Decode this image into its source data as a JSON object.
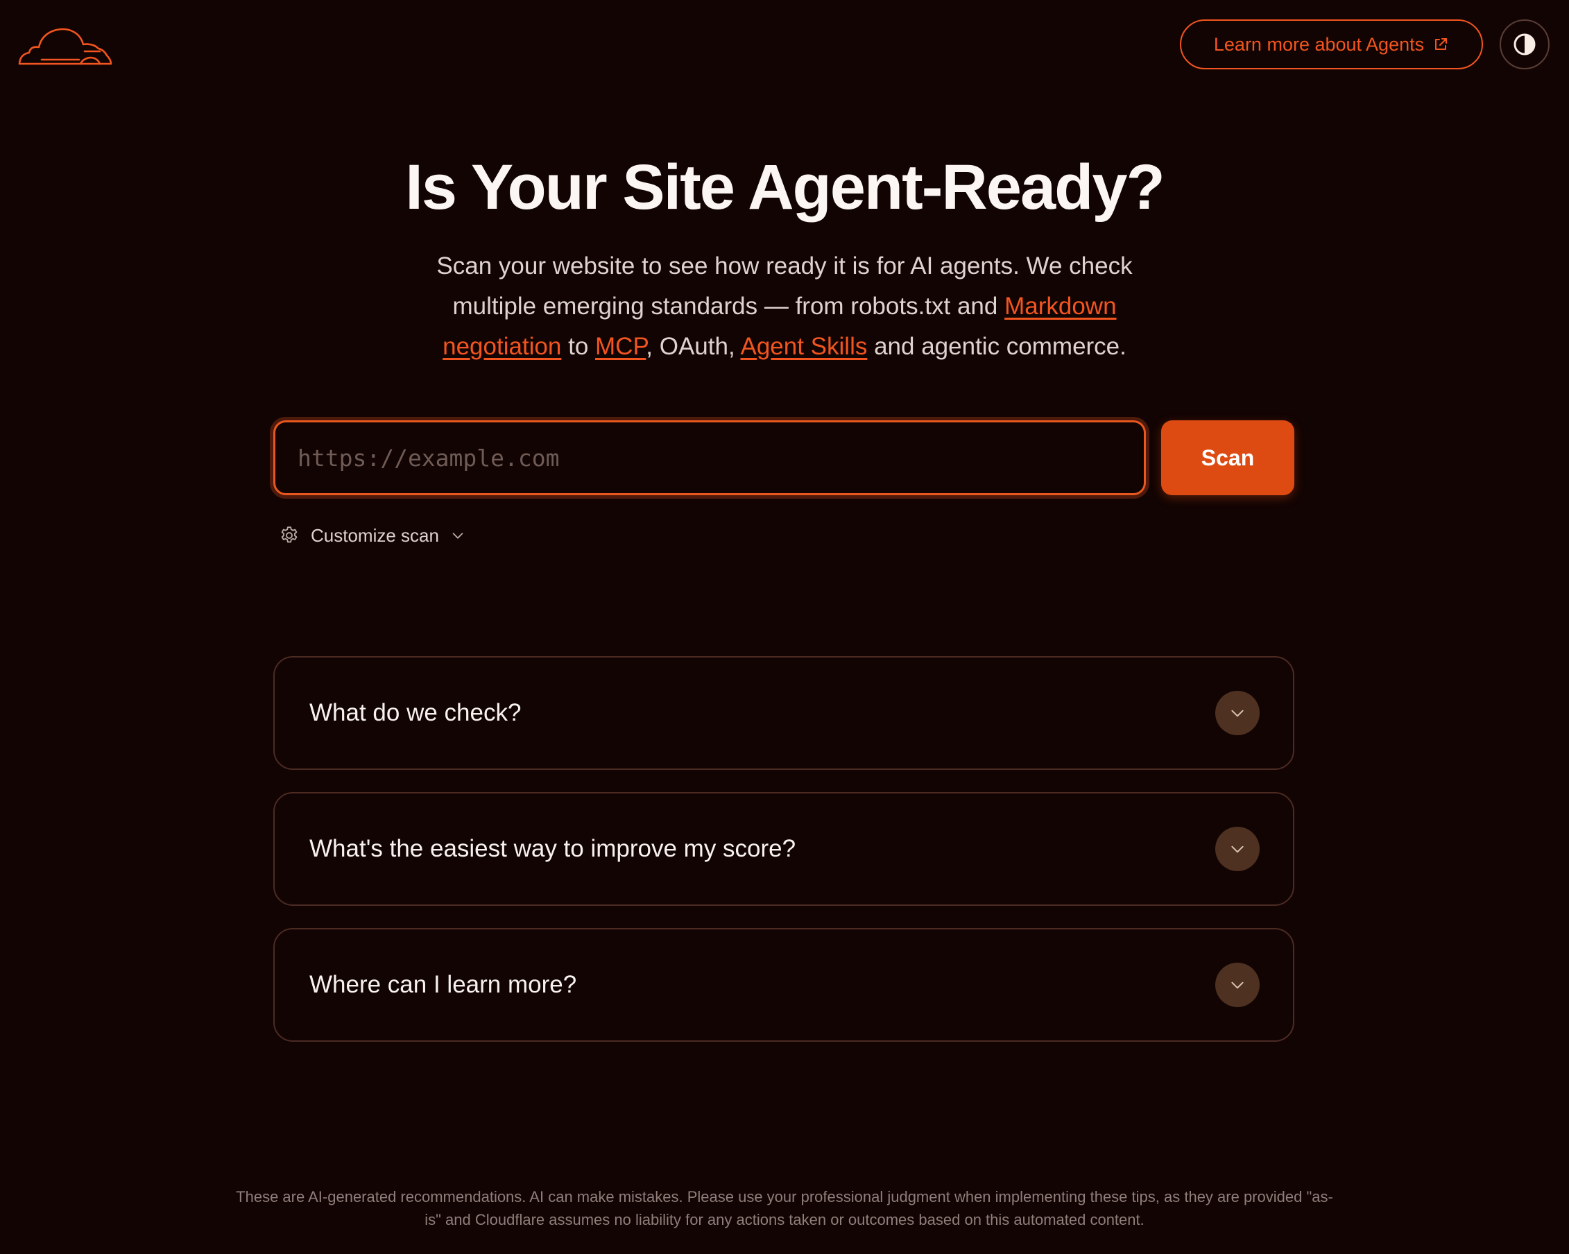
{
  "header": {
    "learn_more_label": "Learn more about Agents",
    "logo_icon": "cloud-logo-icon",
    "theme_icon": "contrast-icon"
  },
  "hero": {
    "title": "Is Your Site Agent-Ready?",
    "subtitle": {
      "part1": "Scan your website to see how ready it is for AI agents. We check multiple emerging standards — from robots.txt and ",
      "link_markdown": "Markdown negotiation",
      "part2": " to ",
      "link_mcp": "MCP",
      "part3": ", OAuth, ",
      "link_skills": "Agent Skills",
      "part4": " and agentic commerce."
    }
  },
  "search": {
    "placeholder": "https://example.com",
    "value": "",
    "scan_label": "Scan",
    "customize_label": "Customize scan"
  },
  "faq": [
    {
      "question": "What do we check?"
    },
    {
      "question": "What's the easiest way to improve my score?"
    },
    {
      "question": "Where can I learn more?"
    }
  ],
  "footer": {
    "disclaimer": "These are AI-generated recommendations. AI can make mistakes. Please use your professional judgment when implementing these tips, as they are provided \"as-is\" and Cloudflare assumes no liability for any actions taken or outcomes based on this automated content."
  },
  "colors": {
    "background": "#120403",
    "accent": "#f2551f",
    "button": "#dd4a12",
    "border": "#4c2b23"
  }
}
